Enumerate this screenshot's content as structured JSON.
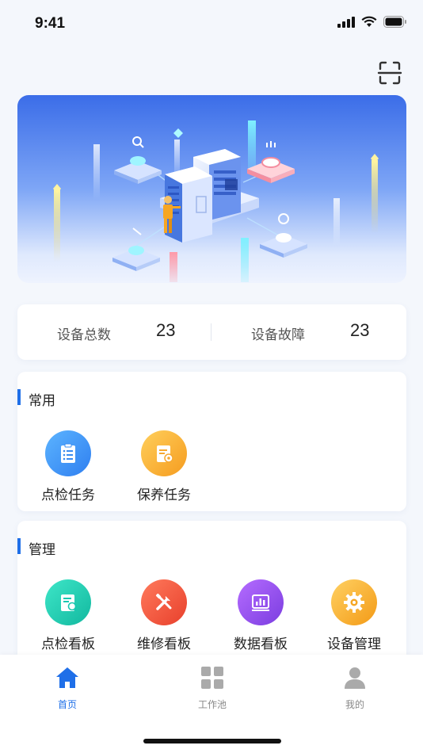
{
  "status_bar": {
    "time": "9:41"
  },
  "stats": {
    "total_label": "设备总数",
    "total_value": "23",
    "fault_label": "设备故障",
    "fault_value": "23"
  },
  "common": {
    "title": "常用",
    "items": [
      {
        "label": "点检任务",
        "icon": "checklist-icon",
        "color": "#3a8cf0"
      },
      {
        "label": "保养任务",
        "icon": "maintenance-doc-icon",
        "color": "#f6a830"
      }
    ]
  },
  "manage": {
    "title": "管理",
    "items": [
      {
        "label": "点检看板",
        "icon": "inspection-board-icon",
        "color": "#18c7b0"
      },
      {
        "label": "维修看板",
        "icon": "tools-icon",
        "color": "#f2553a"
      },
      {
        "label": "数据看板",
        "icon": "bar-chart-icon",
        "color": "#8b4ee8"
      },
      {
        "label": "设备管理",
        "icon": "gear-icon",
        "color": "#f5a623"
      }
    ]
  },
  "tabbar": {
    "items": [
      {
        "label": "首页",
        "icon": "home-icon",
        "active": true
      },
      {
        "label": "工作池",
        "icon": "grid-icon",
        "active": false
      },
      {
        "label": "我的",
        "icon": "user-icon",
        "active": false
      }
    ]
  },
  "colors": {
    "accent": "#1f6fe8",
    "inactive": "#aaaaaa"
  }
}
